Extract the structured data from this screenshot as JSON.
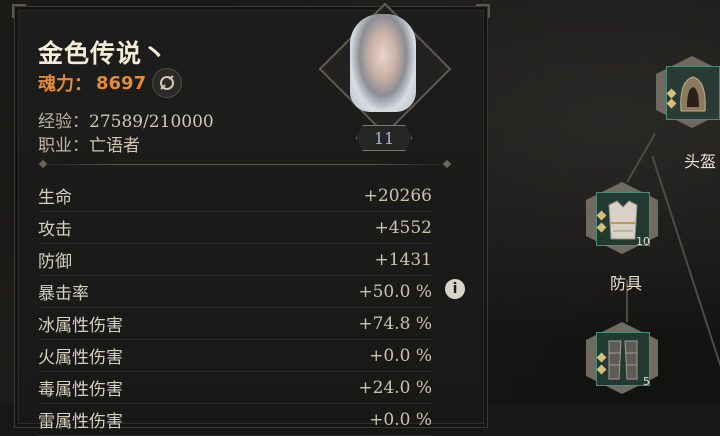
{
  "character": {
    "name": "金色传说丶",
    "power_label": "魂力：",
    "power_value": "8697",
    "exp_label": "经验：",
    "exp_value": "27589/210000",
    "job_label": "职业：",
    "job_value": "亡语者",
    "level": "11"
  },
  "stats": [
    {
      "label": "生命",
      "value": "+20266"
    },
    {
      "label": "攻击",
      "value": "+4552"
    },
    {
      "label": "防御",
      "value": "+1431"
    },
    {
      "label": "暴击率",
      "value": "+50.0 %"
    },
    {
      "label": "冰属性伤害",
      "value": "+74.8 %"
    },
    {
      "label": "火属性伤害",
      "value": "+0.0 %"
    },
    {
      "label": "毒属性伤害",
      "value": "+24.0 %"
    },
    {
      "label": "雷属性伤害",
      "value": "+0.0 %"
    }
  ],
  "equipment": {
    "helmet_label": "头盔",
    "armor_label": "防具",
    "armor_count": "10",
    "legs_count": "5"
  },
  "icons": {
    "info": "i"
  },
  "colors": {
    "power": "#e08a3c",
    "level": "#9fb6d6"
  }
}
